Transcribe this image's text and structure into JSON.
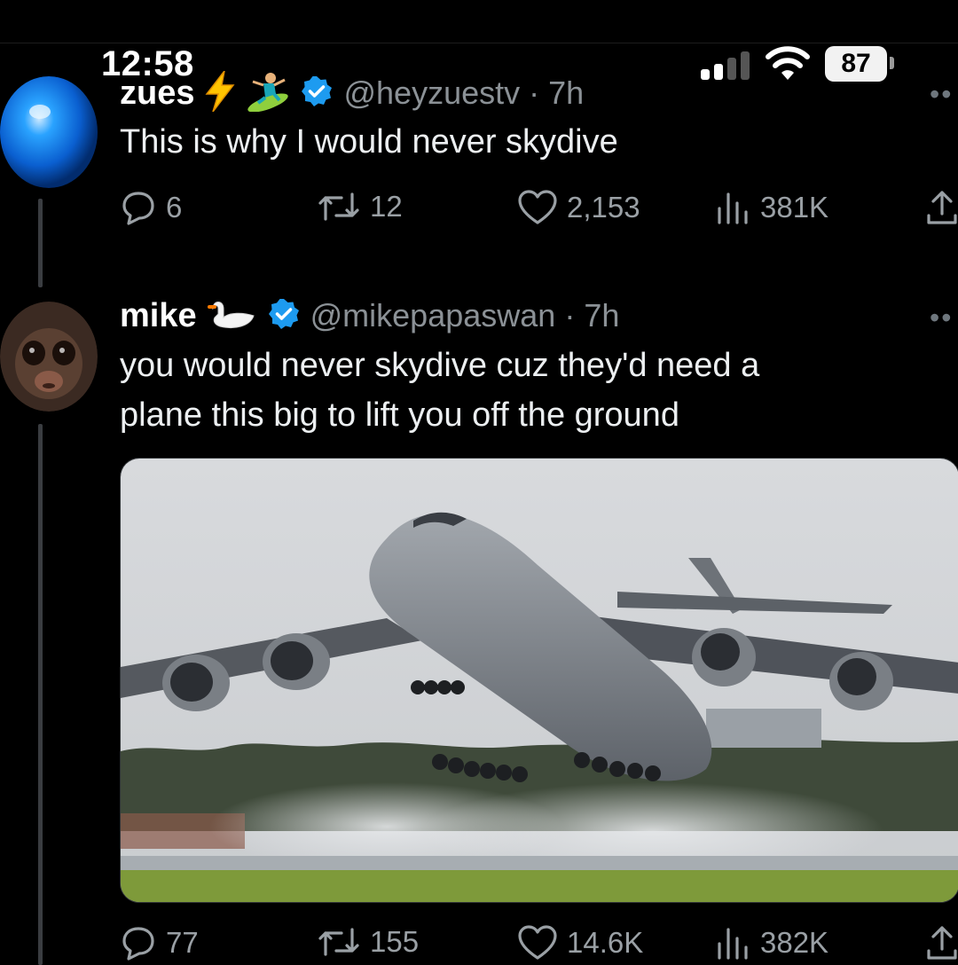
{
  "status_bar": {
    "time": "12:58",
    "battery": "87"
  },
  "tweet1": {
    "name": "zues",
    "handle": "@heyzuestv",
    "time": "7h",
    "text": "This is why I would never skydive",
    "stats": {
      "replies": "6",
      "reposts": "12",
      "likes": "2,153",
      "views": "381K"
    }
  },
  "tweet2": {
    "name": "mike",
    "handle": "@mikepapaswan",
    "time": "7h",
    "text_line1": "you would never skydive cuz they'd need a",
    "text_line2": "plane this big to lift you off the ground",
    "stats": {
      "replies": "77",
      "reposts": "155",
      "likes": "14.6K",
      "views": "382K"
    }
  },
  "icons": {
    "verified": "verified-badge-icon",
    "reply": "reply-icon",
    "repost": "repost-icon",
    "like": "heart-icon",
    "views": "views-icon",
    "share": "share-icon"
  },
  "colors": {
    "verified": "#1d9bf0",
    "background": "#000000",
    "muted": "#8b9196"
  }
}
